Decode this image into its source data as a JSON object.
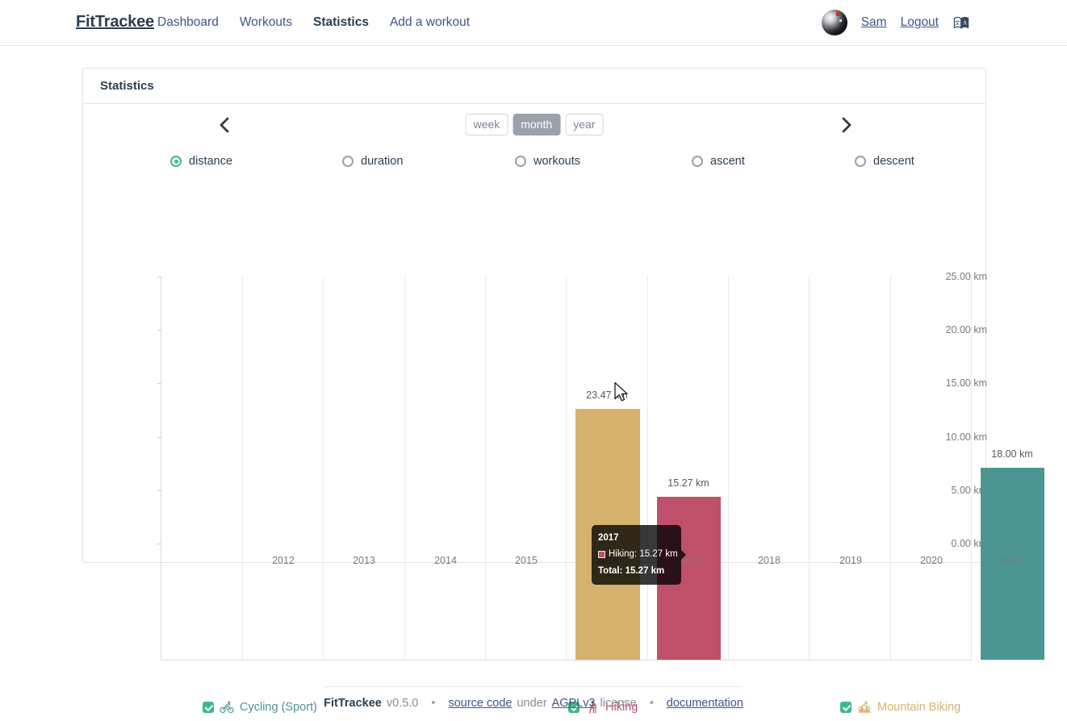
{
  "navbar": {
    "brand": "FitTrackee",
    "links": [
      {
        "label": "Dashboard",
        "active": false
      },
      {
        "label": "Workouts",
        "active": false
      },
      {
        "label": "Statistics",
        "active": true
      },
      {
        "label": "Add a workout",
        "active": false
      }
    ],
    "user": "Sam",
    "logout": "Logout",
    "avatar_icon": "user-avatar-photo",
    "language_icon": "language-switch-icon"
  },
  "card": {
    "title": "Statistics",
    "prev_icon": "chevron-left-icon",
    "next_icon": "chevron-right-icon",
    "periods": [
      {
        "label": "week",
        "active": false
      },
      {
        "label": "month",
        "active": true
      },
      {
        "label": "year",
        "active": false
      }
    ],
    "metrics": [
      {
        "label": "distance",
        "checked": true
      },
      {
        "label": "duration",
        "checked": false
      },
      {
        "label": "workouts",
        "checked": false
      },
      {
        "label": "ascent",
        "checked": false
      },
      {
        "label": "descent",
        "checked": false
      }
    ]
  },
  "chart_data": {
    "type": "bar",
    "title": "",
    "xlabel": "",
    "ylabel": "",
    "categories": [
      "2012",
      "2013",
      "2014",
      "2015",
      "2016",
      "2017",
      "2018",
      "2019",
      "2020",
      "2021"
    ],
    "ylim": [
      0,
      25
    ],
    "yticks": [
      "0.00 km",
      "5.00 km",
      "10.00 km",
      "15.00 km",
      "20.00 km",
      "25.00 km"
    ],
    "ytick_values": [
      0,
      5,
      10,
      15,
      20,
      25
    ],
    "unit": "km",
    "grid": true,
    "legend_position": "bottom",
    "series": [
      {
        "name": "Cycling (Sport)",
        "color": "#4b9690",
        "values": [
          0,
          0,
          0,
          0,
          0,
          0,
          0,
          0,
          0,
          18.0
        ]
      },
      {
        "name": "Hiking",
        "color": "#c0506a",
        "values": [
          0,
          0,
          0,
          0,
          0,
          15.27,
          0,
          0,
          0,
          0
        ]
      },
      {
        "name": "Mountain Biking",
        "color": "#d5b26f",
        "values": [
          0,
          0,
          0,
          0,
          23.47,
          0,
          0,
          0,
          0,
          0
        ]
      }
    ],
    "bars": [
      {
        "category": "2016",
        "value": 23.47,
        "label": "23.47 km",
        "series": "Mountain Biking",
        "color": "#d5b26f"
      },
      {
        "category": "2017",
        "value": 15.27,
        "label": "15.27 km",
        "series": "Hiking",
        "color": "#c0506a"
      },
      {
        "category": "2021",
        "value": 18.0,
        "label": "18.00 km",
        "series": "Cycling (Sport)",
        "color": "#4b9690"
      }
    ]
  },
  "tooltip": {
    "title": "2017",
    "row_label": "Hiking: 15.27 km",
    "total": "Total: 15.27 km",
    "swatch_color": "#c0506a"
  },
  "legend": [
    {
      "label": "Cycling (Sport)",
      "color": "#4b9690",
      "checked": true,
      "icon": "cycling-sport-icon"
    },
    {
      "label": "Hiking",
      "color": "#c0506a",
      "checked": true,
      "icon": "hiking-icon"
    },
    {
      "label": "Mountain Biking",
      "color": "#d5b26f",
      "checked": true,
      "icon": "mountain-biking-icon"
    }
  ],
  "footer": {
    "brand": "FitTrackee",
    "version": "v0.5.0",
    "dot1": "•",
    "source_code": "source code",
    "under": "under",
    "license": "AGPLv3",
    "license_suffix": "license",
    "dot2": "•",
    "documentation": "documentation"
  },
  "cursor": {
    "icon": "mouse-pointer-icon"
  }
}
